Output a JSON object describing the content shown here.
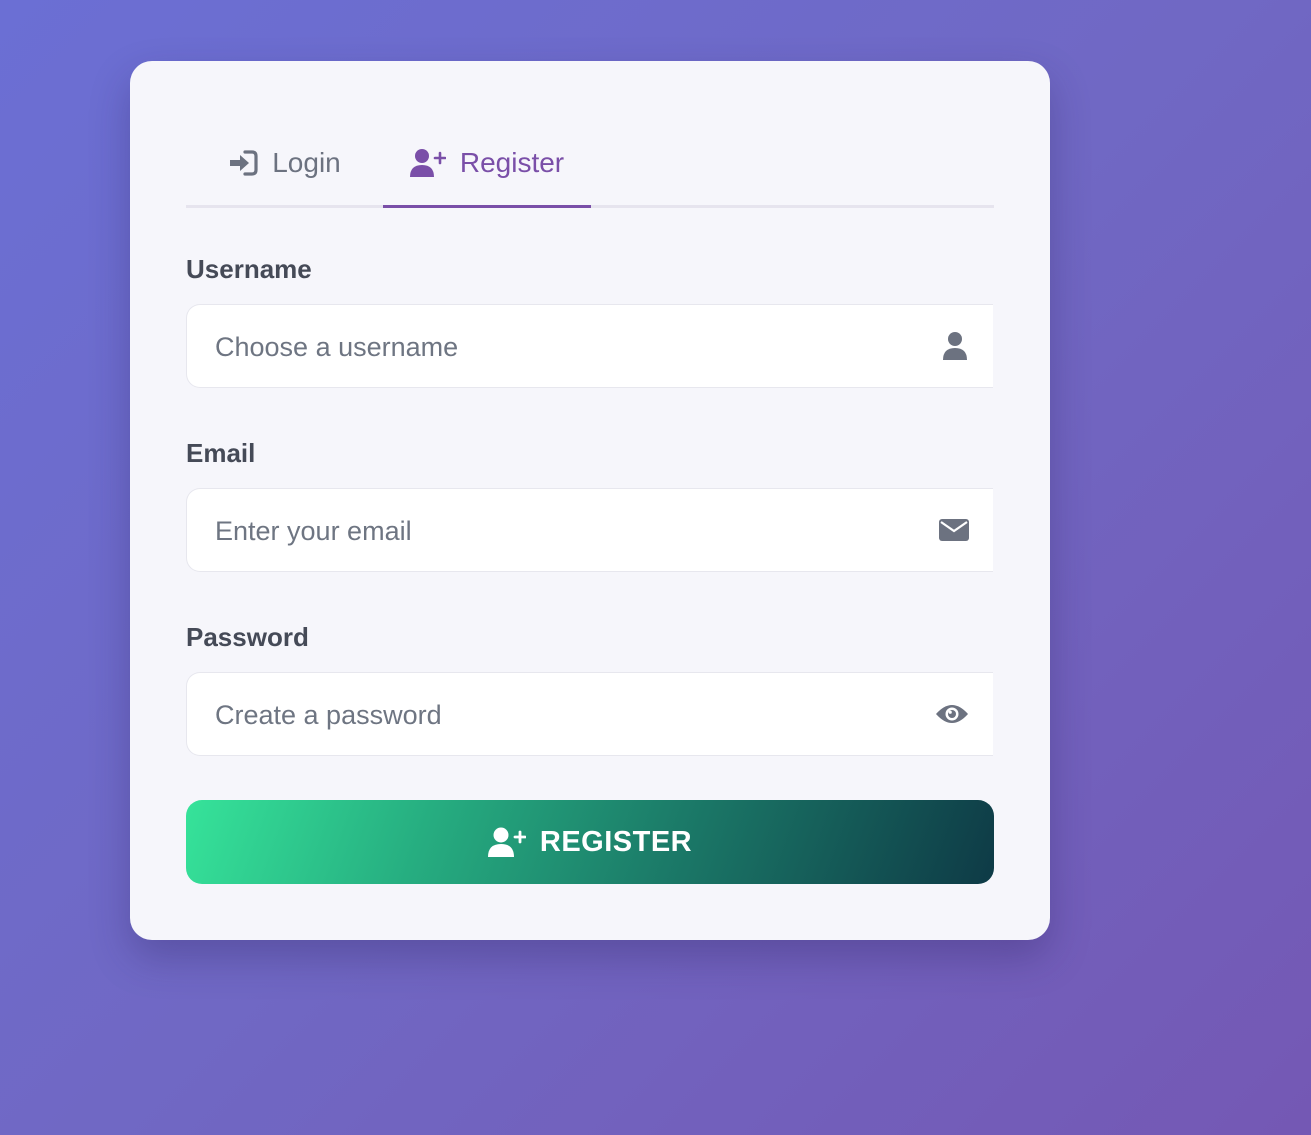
{
  "tabs": {
    "login": {
      "label": "Login",
      "icon": "sign-in-icon"
    },
    "register": {
      "label": "Register",
      "icon": "user-plus-icon",
      "active": true
    }
  },
  "form": {
    "username": {
      "label": "Username",
      "placeholder": "Choose a username",
      "icon": "user-icon"
    },
    "email": {
      "label": "Email",
      "placeholder": "Enter your email",
      "icon": "envelope-icon"
    },
    "password": {
      "label": "Password",
      "placeholder": "Create a password",
      "icon": "eye-icon"
    }
  },
  "submit": {
    "label": "REGISTER",
    "icon": "user-plus-icon"
  },
  "colors": {
    "accent": "#7a4fa8",
    "background_start": "#6b6fd4",
    "background_end": "#7458b4",
    "button_start": "#36e39a",
    "button_end": "#0e3a46"
  }
}
